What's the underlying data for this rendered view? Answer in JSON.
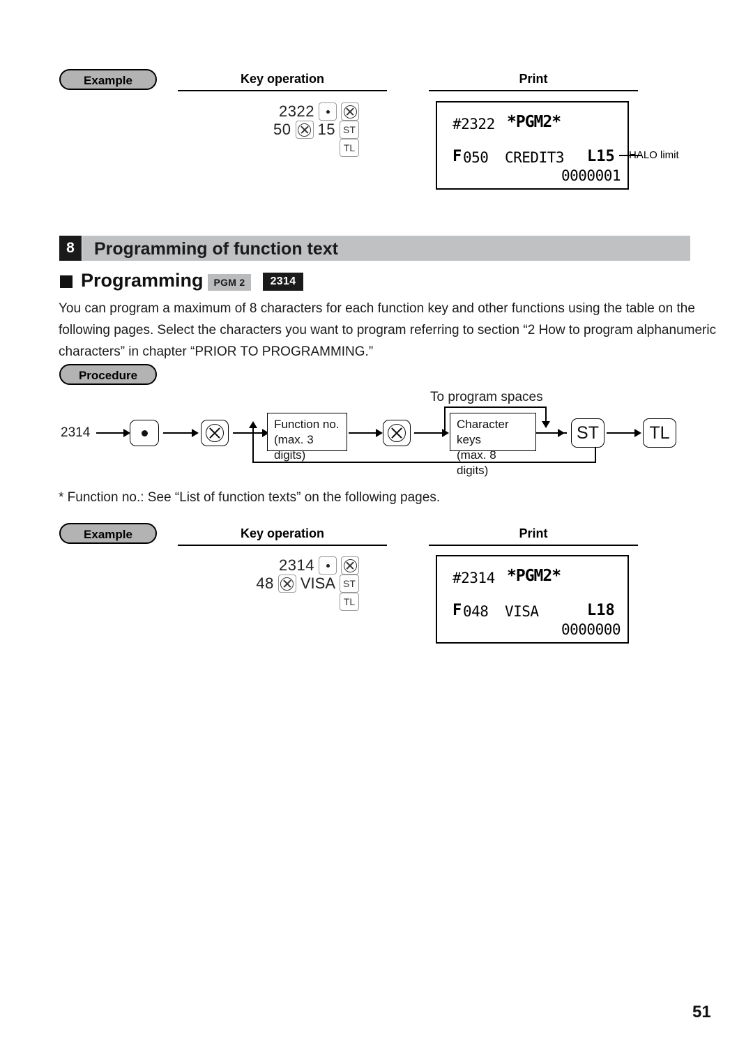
{
  "page": {
    "number": "51"
  },
  "example_top": {
    "badge": "Example",
    "col_key_operation": "Key operation",
    "col_print": "Print",
    "keys": {
      "row1_number": "2322",
      "row1_key_dot": "decimal-point-key",
      "row1_key_multiply": "multiply-key",
      "row2_number_a": "50",
      "row2_key_multiply": "multiply-key",
      "row2_number_b": "15",
      "row2_key_st": "ST",
      "row3_key_tl": "TL"
    },
    "receipt": {
      "line1_hash": "#2322",
      "line1_mode": "*PGM2*",
      "line2_f": "F",
      "line2_num": "050",
      "line2_text": "CREDIT3",
      "line2_right": "L15",
      "line3": "0000001"
    },
    "callout": "HALO limit"
  },
  "section": {
    "number": "8",
    "title": "Programming of function text"
  },
  "subsection": {
    "title": "Programming",
    "tag_mode": "PGM 2",
    "tag_code": "2314"
  },
  "body": {
    "paragraph": "You can program a maximum of 8 characters for each function key and other functions using the table on the following pages. Select the characters you want to program referring to section “2 How to program alphanumeric characters” in chapter “PRIOR TO PROGRAMMING.”"
  },
  "procedure": {
    "badge": "Procedure",
    "start_code": "2314",
    "key_dot": "decimal-point-key",
    "key_multiply_1": "multiply-key",
    "box_function_no_line1": "Function no.",
    "box_function_no_line2": "(max. 3 digits)",
    "key_multiply_2": "multiply-key",
    "loop_label": "To program spaces",
    "box_character_keys_line1": "Character keys",
    "box_character_keys_line2": "(max. 8 digits)",
    "key_st": "ST",
    "key_tl": "TL",
    "footnote": "* Function no.: See “List of function texts” on the following pages."
  },
  "example_bottom": {
    "badge": "Example",
    "col_key_operation": "Key operation",
    "col_print": "Print",
    "keys": {
      "row1_number": "2314",
      "row1_key_dot": "decimal-point-key",
      "row1_key_multiply": "multiply-key",
      "row2_number_a": "48",
      "row2_key_multiply": "multiply-key",
      "row2_text": "VISA",
      "row2_key_st": "ST",
      "row3_key_tl": "TL"
    },
    "receipt": {
      "line1_hash": "#2314",
      "line1_mode": "*PGM2*",
      "line2_f": "F",
      "line2_num": "048",
      "line2_text": "VISA",
      "line2_right": "L18",
      "line3": "0000000"
    }
  },
  "colors": {
    "bar_gray": "#bfc1c3",
    "pill_gray": "#b3b3b3",
    "tag_gray": "#b9bbbd",
    "tag_black": "#1a1a1a"
  }
}
